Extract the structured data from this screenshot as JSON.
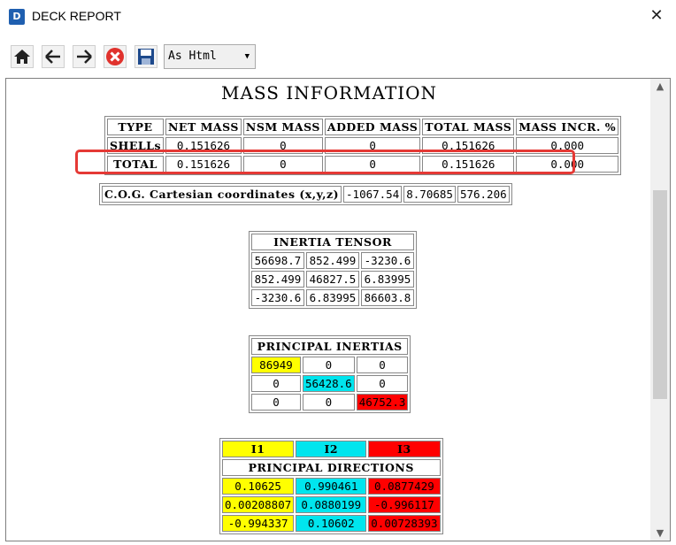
{
  "window": {
    "title": "DECK REPORT",
    "close_glyph": "✕"
  },
  "toolbar": {
    "format_select": "As Html",
    "icons": [
      "home-icon",
      "back-arrow-icon",
      "forward-arrow-icon",
      "stop-icon",
      "save-icon"
    ]
  },
  "report": {
    "heading": "MASS INFORMATION",
    "mass_table": {
      "headers": [
        "TYPE",
        "NET MASS",
        "NSM MASS",
        "ADDED MASS",
        "TOTAL MASS",
        "MASS INCR. %"
      ],
      "rows": [
        [
          "SHELLs",
          "0.151626",
          "0",
          "0",
          "0.151626",
          "0.000"
        ],
        [
          "TOTAL",
          "0.151626",
          "0",
          "0",
          "0.151626",
          "0.000"
        ]
      ]
    },
    "cog": {
      "label": "C.O.G. Cartesian coordinates (x,y,z)",
      "values": [
        "-1067.54",
        "8.70685",
        "576.206"
      ]
    },
    "inertia_tensor": {
      "title": "INERTIA TENSOR",
      "rows": [
        [
          "56698.7",
          "852.499",
          "-3230.6"
        ],
        [
          "852.499",
          "46827.5",
          "6.83995"
        ],
        [
          "-3230.6",
          "6.83995",
          "86603.8"
        ]
      ]
    },
    "principal_inertias": {
      "title": "PRINCIPAL INERTIAS",
      "rows": [
        [
          "86949",
          "0",
          "0"
        ],
        [
          "0",
          "56428.6",
          "0"
        ],
        [
          "0",
          "0",
          "46752.3"
        ]
      ]
    },
    "principal_directions": {
      "headers": [
        "I1",
        "I2",
        "I3"
      ],
      "title": "PRINCIPAL DIRECTIONS",
      "rows": [
        [
          "0.10625",
          "0.990461",
          "0.0877429"
        ],
        [
          "0.00208807",
          "0.0880199",
          "-0.996117"
        ],
        [
          "-0.994337",
          "0.10602",
          "0.00728393"
        ]
      ]
    },
    "colors": {
      "i1": "#ffff00",
      "i2": "#00e5ee",
      "i3": "#ff0000",
      "highlight": "#e53935"
    }
  }
}
